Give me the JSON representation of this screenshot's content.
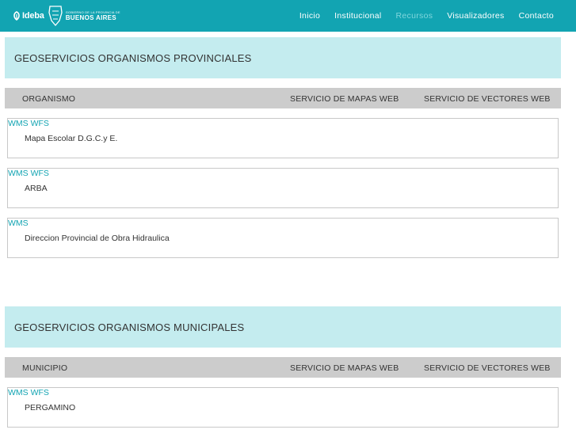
{
  "brand": {
    "logo_text": "Ideba",
    "gov_small": "GOBIERNO DE LA PROVINCIA DE",
    "gov_big": "BUENOS AIRES"
  },
  "nav": {
    "items": [
      {
        "label": "Inicio",
        "active": false
      },
      {
        "label": "Institucional",
        "active": false
      },
      {
        "label": "Recursos",
        "active": true
      },
      {
        "label": "Visualizadores",
        "active": false
      },
      {
        "label": "Contacto",
        "active": false
      }
    ]
  },
  "sections": [
    {
      "title": "GEOSERVICIOS ORGANISMOS PROVINCIALES",
      "columns": [
        "ORGANISMO",
        "SERVICIO DE MAPAS WEB",
        "SERVICIO DE VECTORES WEB"
      ],
      "rows": [
        {
          "name": "Mapa Escolar D.G.C.y E.",
          "wms": "WMS",
          "wfs": "WFS"
        },
        {
          "name": "ARBA",
          "wms": "WMS",
          "wfs": "WFS"
        },
        {
          "name": "Direccion Provincial de Obra Hidraulica",
          "wms": "WMS",
          "wfs": ""
        }
      ]
    },
    {
      "title": "GEOSERVICIOS ORGANISMOS MUNICIPALES",
      "columns": [
        "MUNICIPIO",
        "SERVICIO DE MAPAS WEB",
        "SERVICIO DE VECTORES WEB"
      ],
      "rows": [
        {
          "name": "PERGAMINO",
          "wms": "WMS",
          "wfs": "WFS"
        }
      ]
    }
  ],
  "colors": {
    "navbar": "#12a4b2",
    "section_header": "#c4ecef",
    "column_header": "#cccccc",
    "link": "#12a4b2",
    "active_nav": "#7fd6dd"
  }
}
